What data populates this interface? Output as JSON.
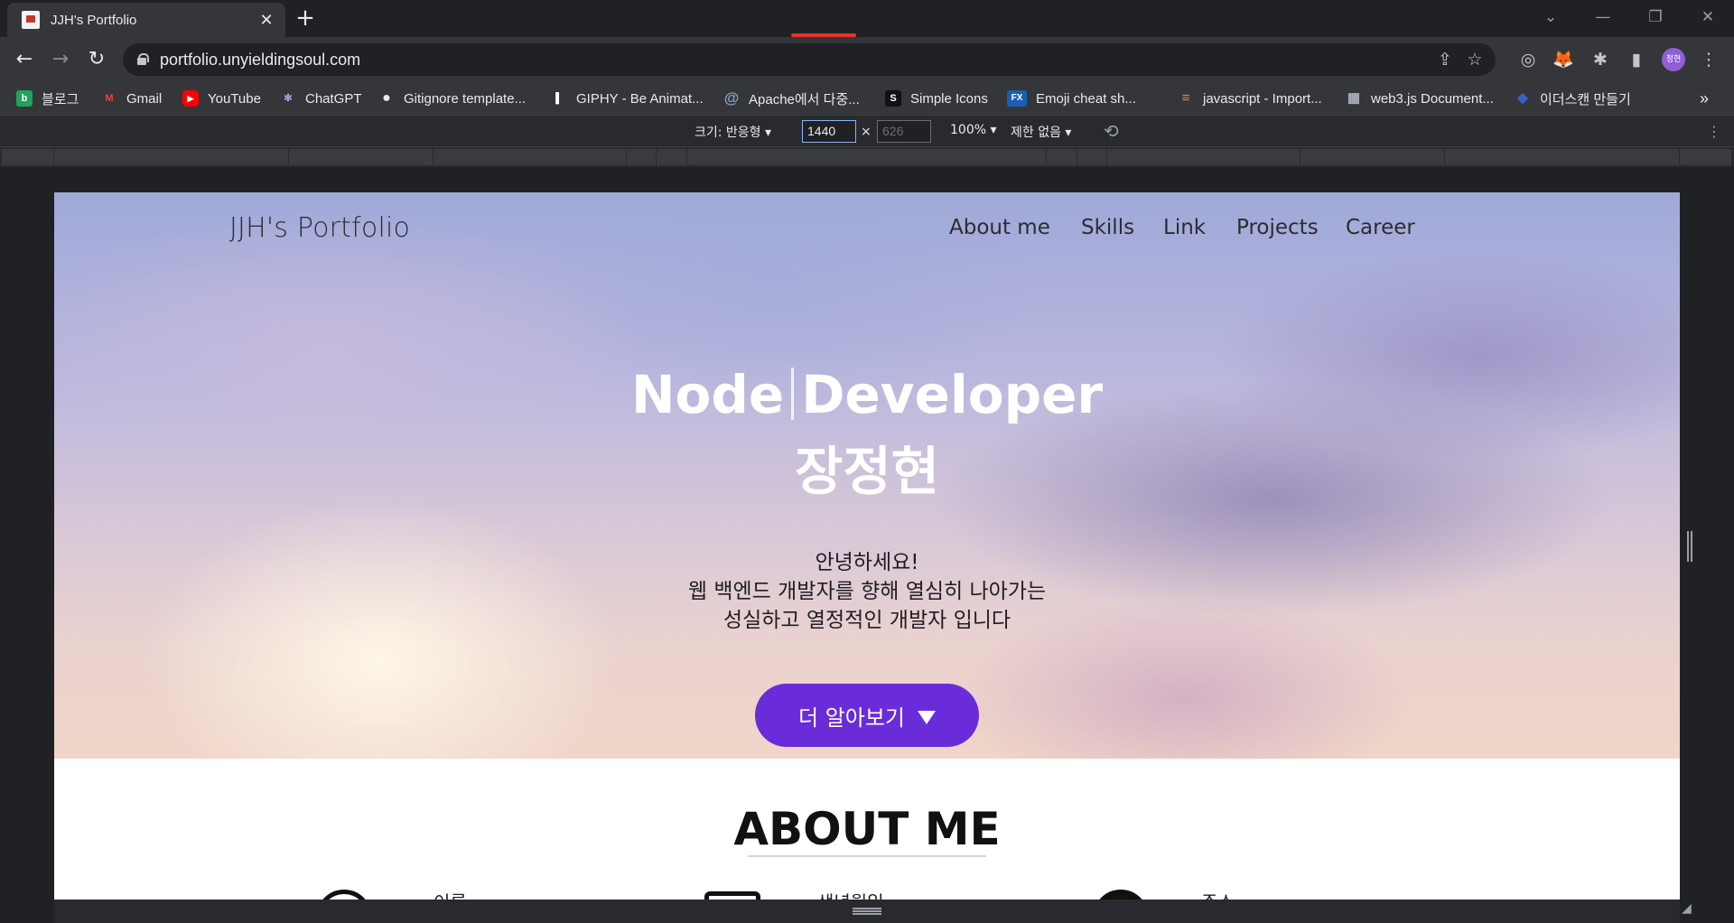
{
  "browser": {
    "tab": {
      "title": "JJH's Portfolio",
      "close": "✕"
    },
    "new_tab": "+",
    "window_controls": {
      "tab_search": "⌄",
      "minimize": "—",
      "restore": "❐",
      "close": "✕"
    },
    "nav": {
      "back": "←",
      "forward": "→",
      "reload": "↻"
    },
    "url": "portfolio.unyieldingsoul.com",
    "omnibox_icons": {
      "share": "⇪",
      "bookmark": "☆"
    },
    "extensions": {
      "ext1": "◎",
      "ext2": "🦊",
      "puzzle": "✱",
      "sidepanel": "▮",
      "menu": "⋮"
    },
    "profile_initials": "정현"
  },
  "bookmarks": [
    {
      "label": "블로그",
      "icon": "blog-icon",
      "icon_text": "b",
      "color": "#21a35a"
    },
    {
      "label": "Gmail",
      "icon": "gmail-icon",
      "icon_text": "M",
      "color": "#ea4335"
    },
    {
      "label": "YouTube",
      "icon": "youtube-icon",
      "icon_text": "▶",
      "color": "#ff0000"
    },
    {
      "label": "ChatGPT",
      "icon": "chatgpt-icon",
      "icon_text": "✻",
      "color": "#6b5aa8"
    },
    {
      "label": "Gitignore template...",
      "icon": "github-icon",
      "icon_text": "●",
      "color": "#e8eaed"
    },
    {
      "label": "GIPHY - Be Animat...",
      "icon": "giphy-icon",
      "icon_text": "▌",
      "color": "#ffffff"
    },
    {
      "label": "Apache에서 다중...",
      "icon": "at-icon",
      "icon_text": "@",
      "color": "#8aa0c8"
    },
    {
      "label": "Simple Icons",
      "icon": "simpleicons-icon",
      "icon_text": "S",
      "color": "#111111"
    },
    {
      "label": "Emoji cheat sh...",
      "icon": "fx-icon",
      "icon_text": "FX",
      "color": "#1a5fb4"
    },
    {
      "label": "javascript - Import...",
      "icon": "stackoverflow-icon",
      "icon_text": "≡",
      "color": "#f48024"
    },
    {
      "label": "web3.js Document...",
      "icon": "docs-icon",
      "icon_text": "▦",
      "color": "#5a6270"
    },
    {
      "label": "이더스캔 만들기",
      "icon": "cube-icon",
      "icon_text": "◆",
      "color": "#3b5ec9"
    }
  ],
  "bookmarks_overflow": "»",
  "devtools": {
    "size_label": "크기: 반응형 ▾",
    "width": "1440",
    "times": "×",
    "height": "626",
    "zoom": "100% ▾",
    "throttle": "제한 없음 ▾",
    "rotate": "⟲",
    "more": "⋮"
  },
  "site": {
    "logo": "JJH's Portfolio",
    "nav": [
      "About me",
      "Skills",
      "Link",
      "Projects",
      "Career"
    ],
    "hero": {
      "title_part1": "Node",
      "title_part2": "Developer",
      "name": "장정현",
      "desc_lines": [
        "안녕하세요!",
        "웹 백엔드 개발자를 향해 열심히 나아가는",
        "성실하고 열정적인 개발자 입니다"
      ],
      "cta": "더 알아보기"
    },
    "about": {
      "title": "ABOUT ME",
      "items": [
        "이름",
        "생년월일",
        "주소"
      ]
    }
  },
  "colors": {
    "accent": "#6a2bd9",
    "devtools_highlight": "#e8322b"
  }
}
